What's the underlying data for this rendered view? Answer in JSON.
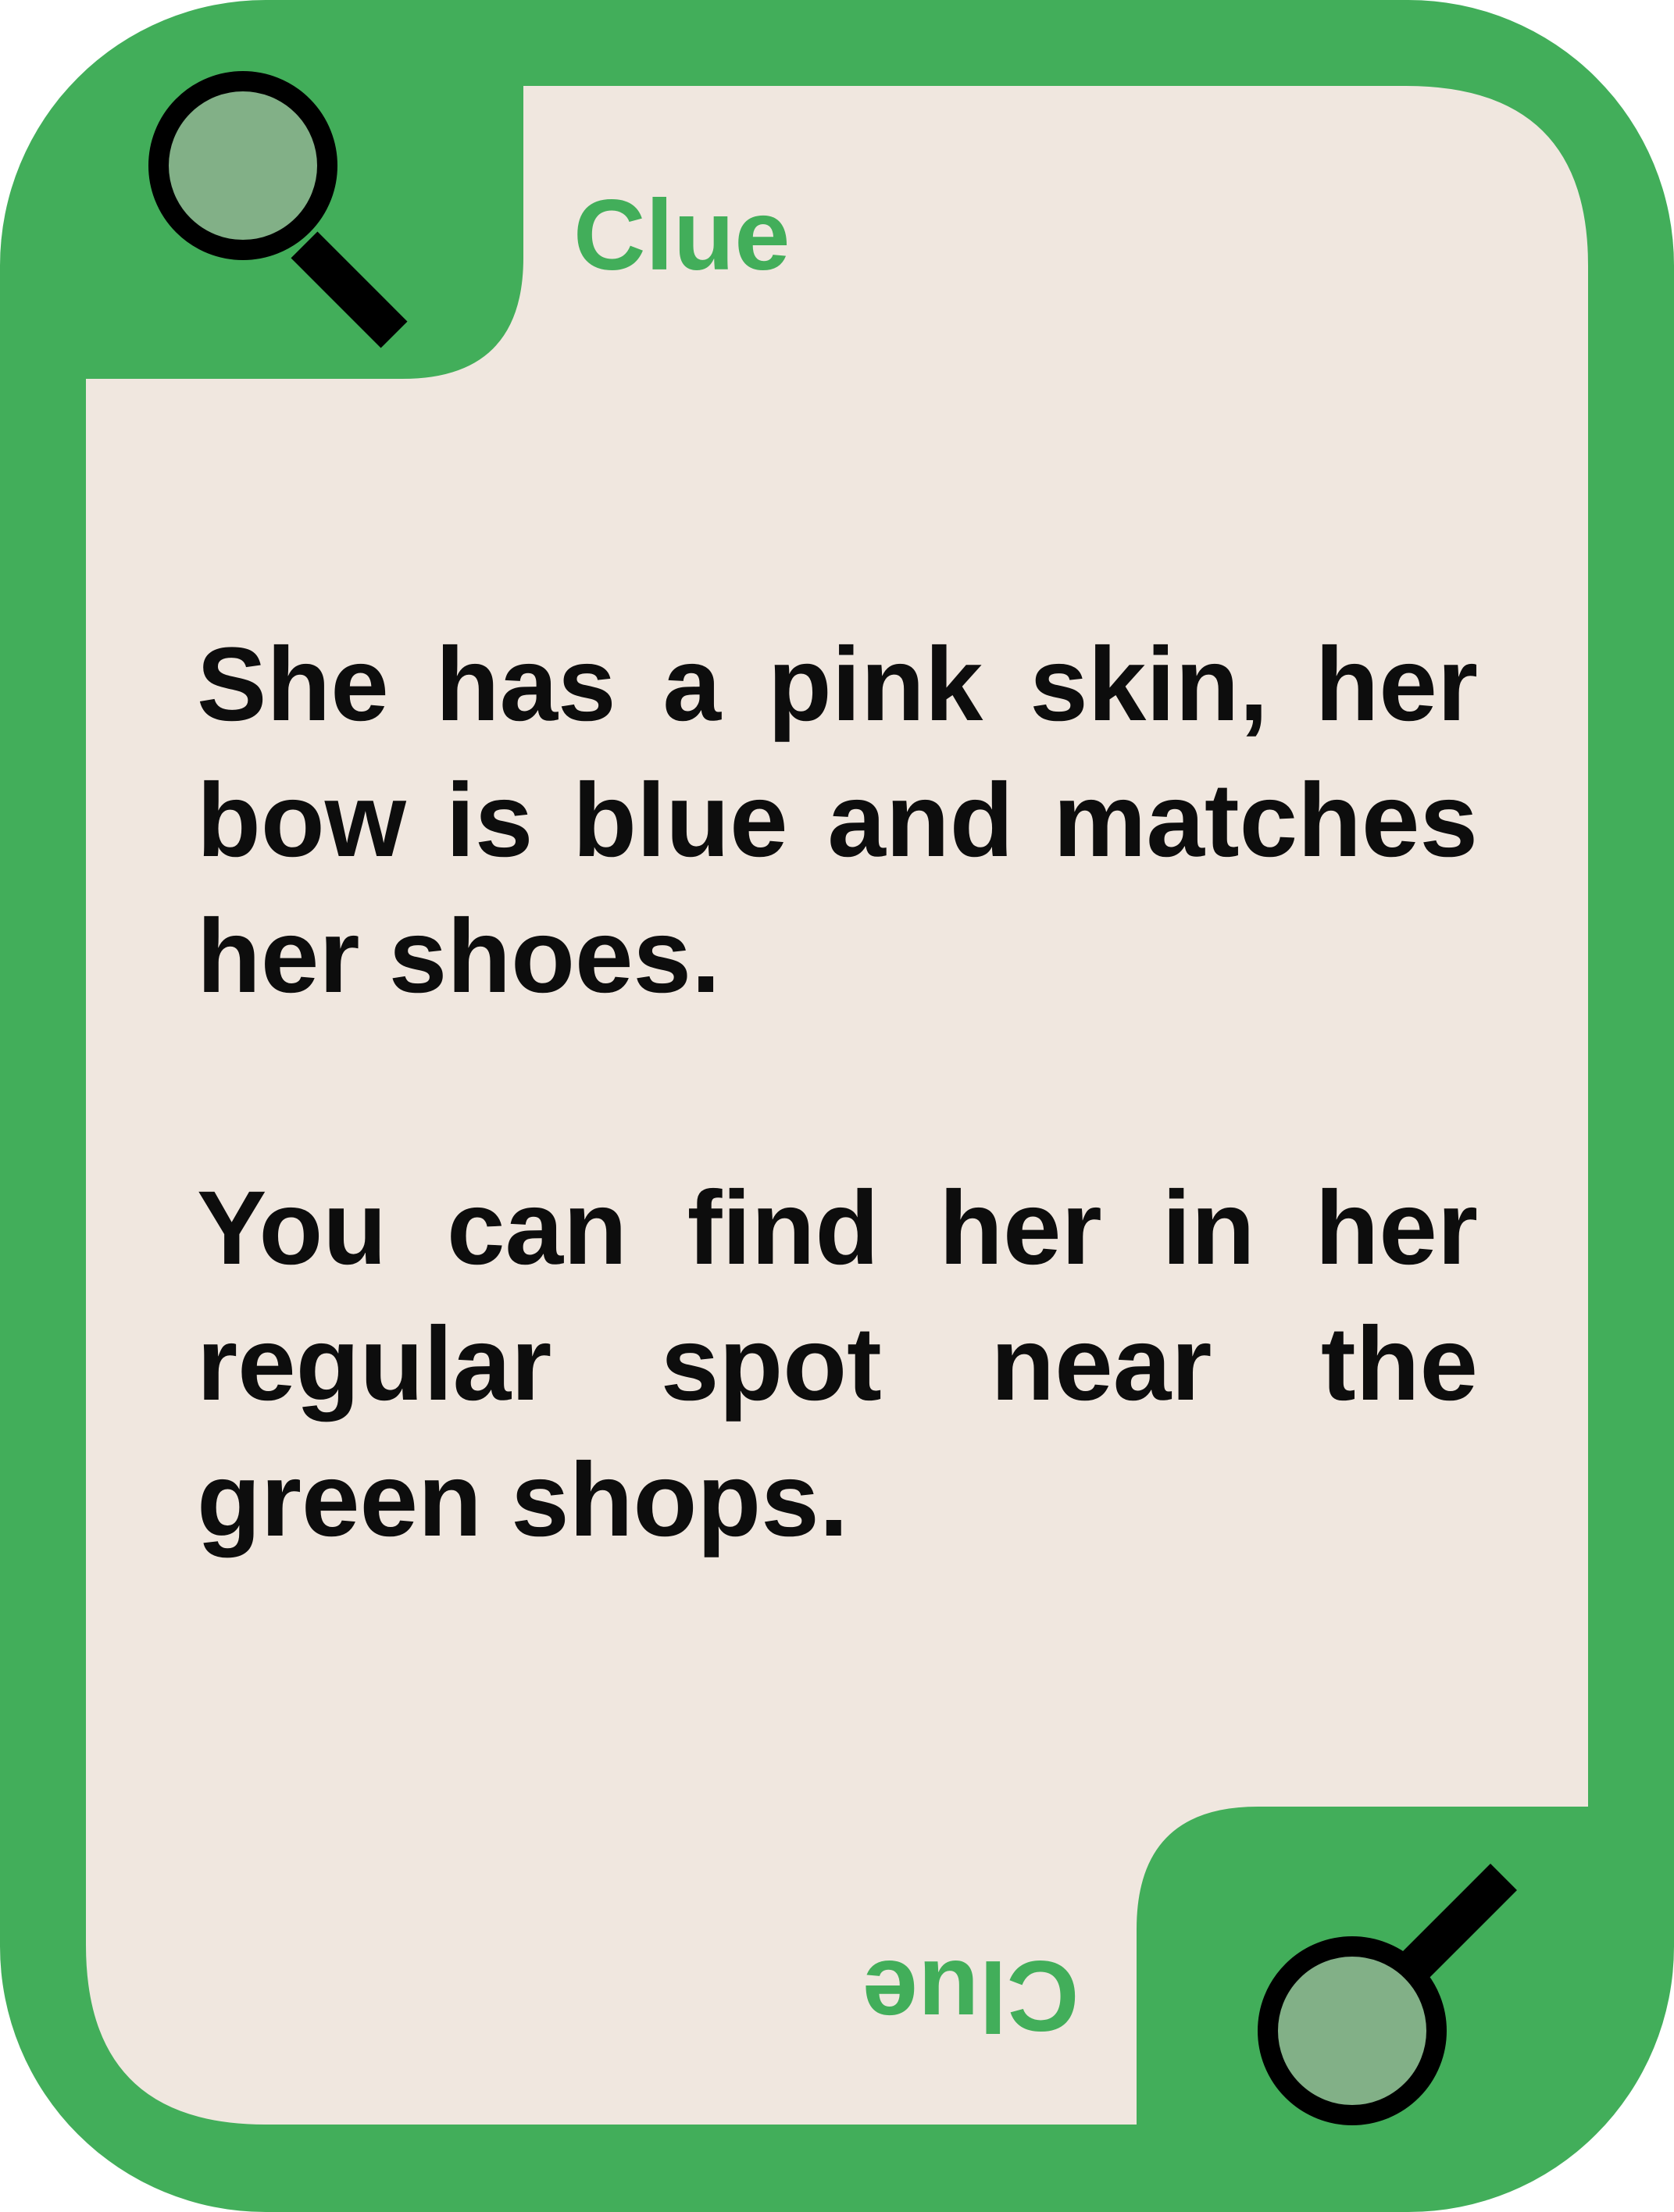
{
  "card": {
    "top_label": "Clue",
    "bottom_label": "Clue",
    "paragraphs": [
      "She has a pink skin, her bow is blue and matches her shoes.",
      "You can find her in her regular spot near the green shops."
    ]
  },
  "icons": {
    "top_left": "magnifying-glass-icon",
    "bottom_right": "magnifying-glass-icon"
  },
  "colors": {
    "border": "#42AE5A",
    "paper": "#F0E7DF",
    "lens": "#82B087",
    "text": "#0D0D0D",
    "label": "#42AE5A"
  }
}
